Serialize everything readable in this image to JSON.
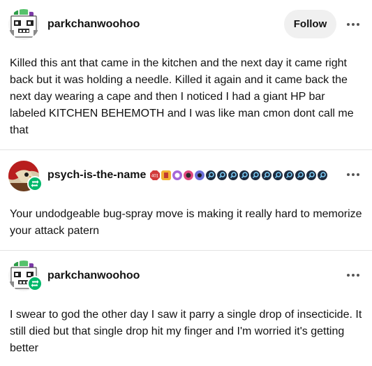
{
  "posts": [
    {
      "username": "parkchanwoohoo",
      "follow_label": "Follow",
      "text": "Killed this ant that came in the kitchen and the next day it came right back but it was holding a needle. Killed it again and it came back the next day wearing a cape and then I noticed I had a giant HP bar labeled KITCHEN BEHEMOTH and I was like man cmon dont call me that"
    },
    {
      "username": "psych-is-the-name",
      "badges": [
        "badge-icon",
        "badge-icon",
        "badge-icon",
        "badge-icon",
        "badge-icon",
        "badge-icon",
        "badge-icon",
        "badge-icon",
        "badge-icon",
        "badge-icon",
        "badge-icon",
        "badge-icon",
        "badge-icon",
        "badge-icon",
        "badge-icon",
        "badge-icon"
      ],
      "text": "Your undodgeable bug-spray move is making it really hard to memorize your attack patern"
    },
    {
      "username": "parkchanwoohoo",
      "text": "I swear to god the other day I saw it parry a single drop of insecticide. It still died but that single drop hit my finger and I'm worried it's getting better"
    }
  ],
  "colors": {
    "text": "#121212",
    "follow_bg": "#f0f0f0",
    "reblog_badge": "#00b86b",
    "divider": "#e3e3e3"
  },
  "icons": {
    "more": "more-dots-icon",
    "reblog": "reblog-icon"
  }
}
